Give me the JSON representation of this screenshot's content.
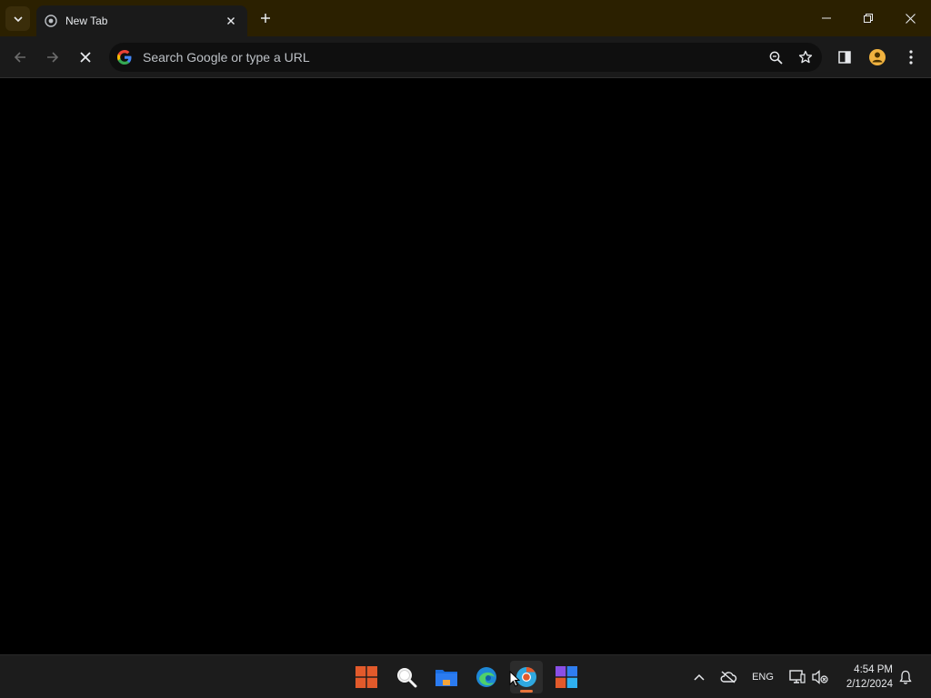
{
  "tab": {
    "title": "New Tab"
  },
  "omnibox": {
    "placeholder": "Search Google or type a URL",
    "value": ""
  },
  "taskbar": {
    "apps": [
      {
        "name": "Start",
        "icon": "windows-logo-icon"
      },
      {
        "name": "Search",
        "icon": "search-icon"
      },
      {
        "name": "File Explorer",
        "icon": "folder-icon"
      },
      {
        "name": "Edge",
        "icon": "edge-icon"
      },
      {
        "name": "Chrome",
        "icon": "chrome-icon",
        "active": true
      },
      {
        "name": "Store",
        "icon": "store-icon"
      }
    ],
    "language": "ENG",
    "time": "4:54 PM",
    "date": "2/12/2024"
  },
  "colors": {
    "tab_strip": "#2b2000",
    "toolbar": "#1a1a1a",
    "content": "#000000",
    "taskbar": "#1c1c1c",
    "accent": "#e8743b"
  }
}
